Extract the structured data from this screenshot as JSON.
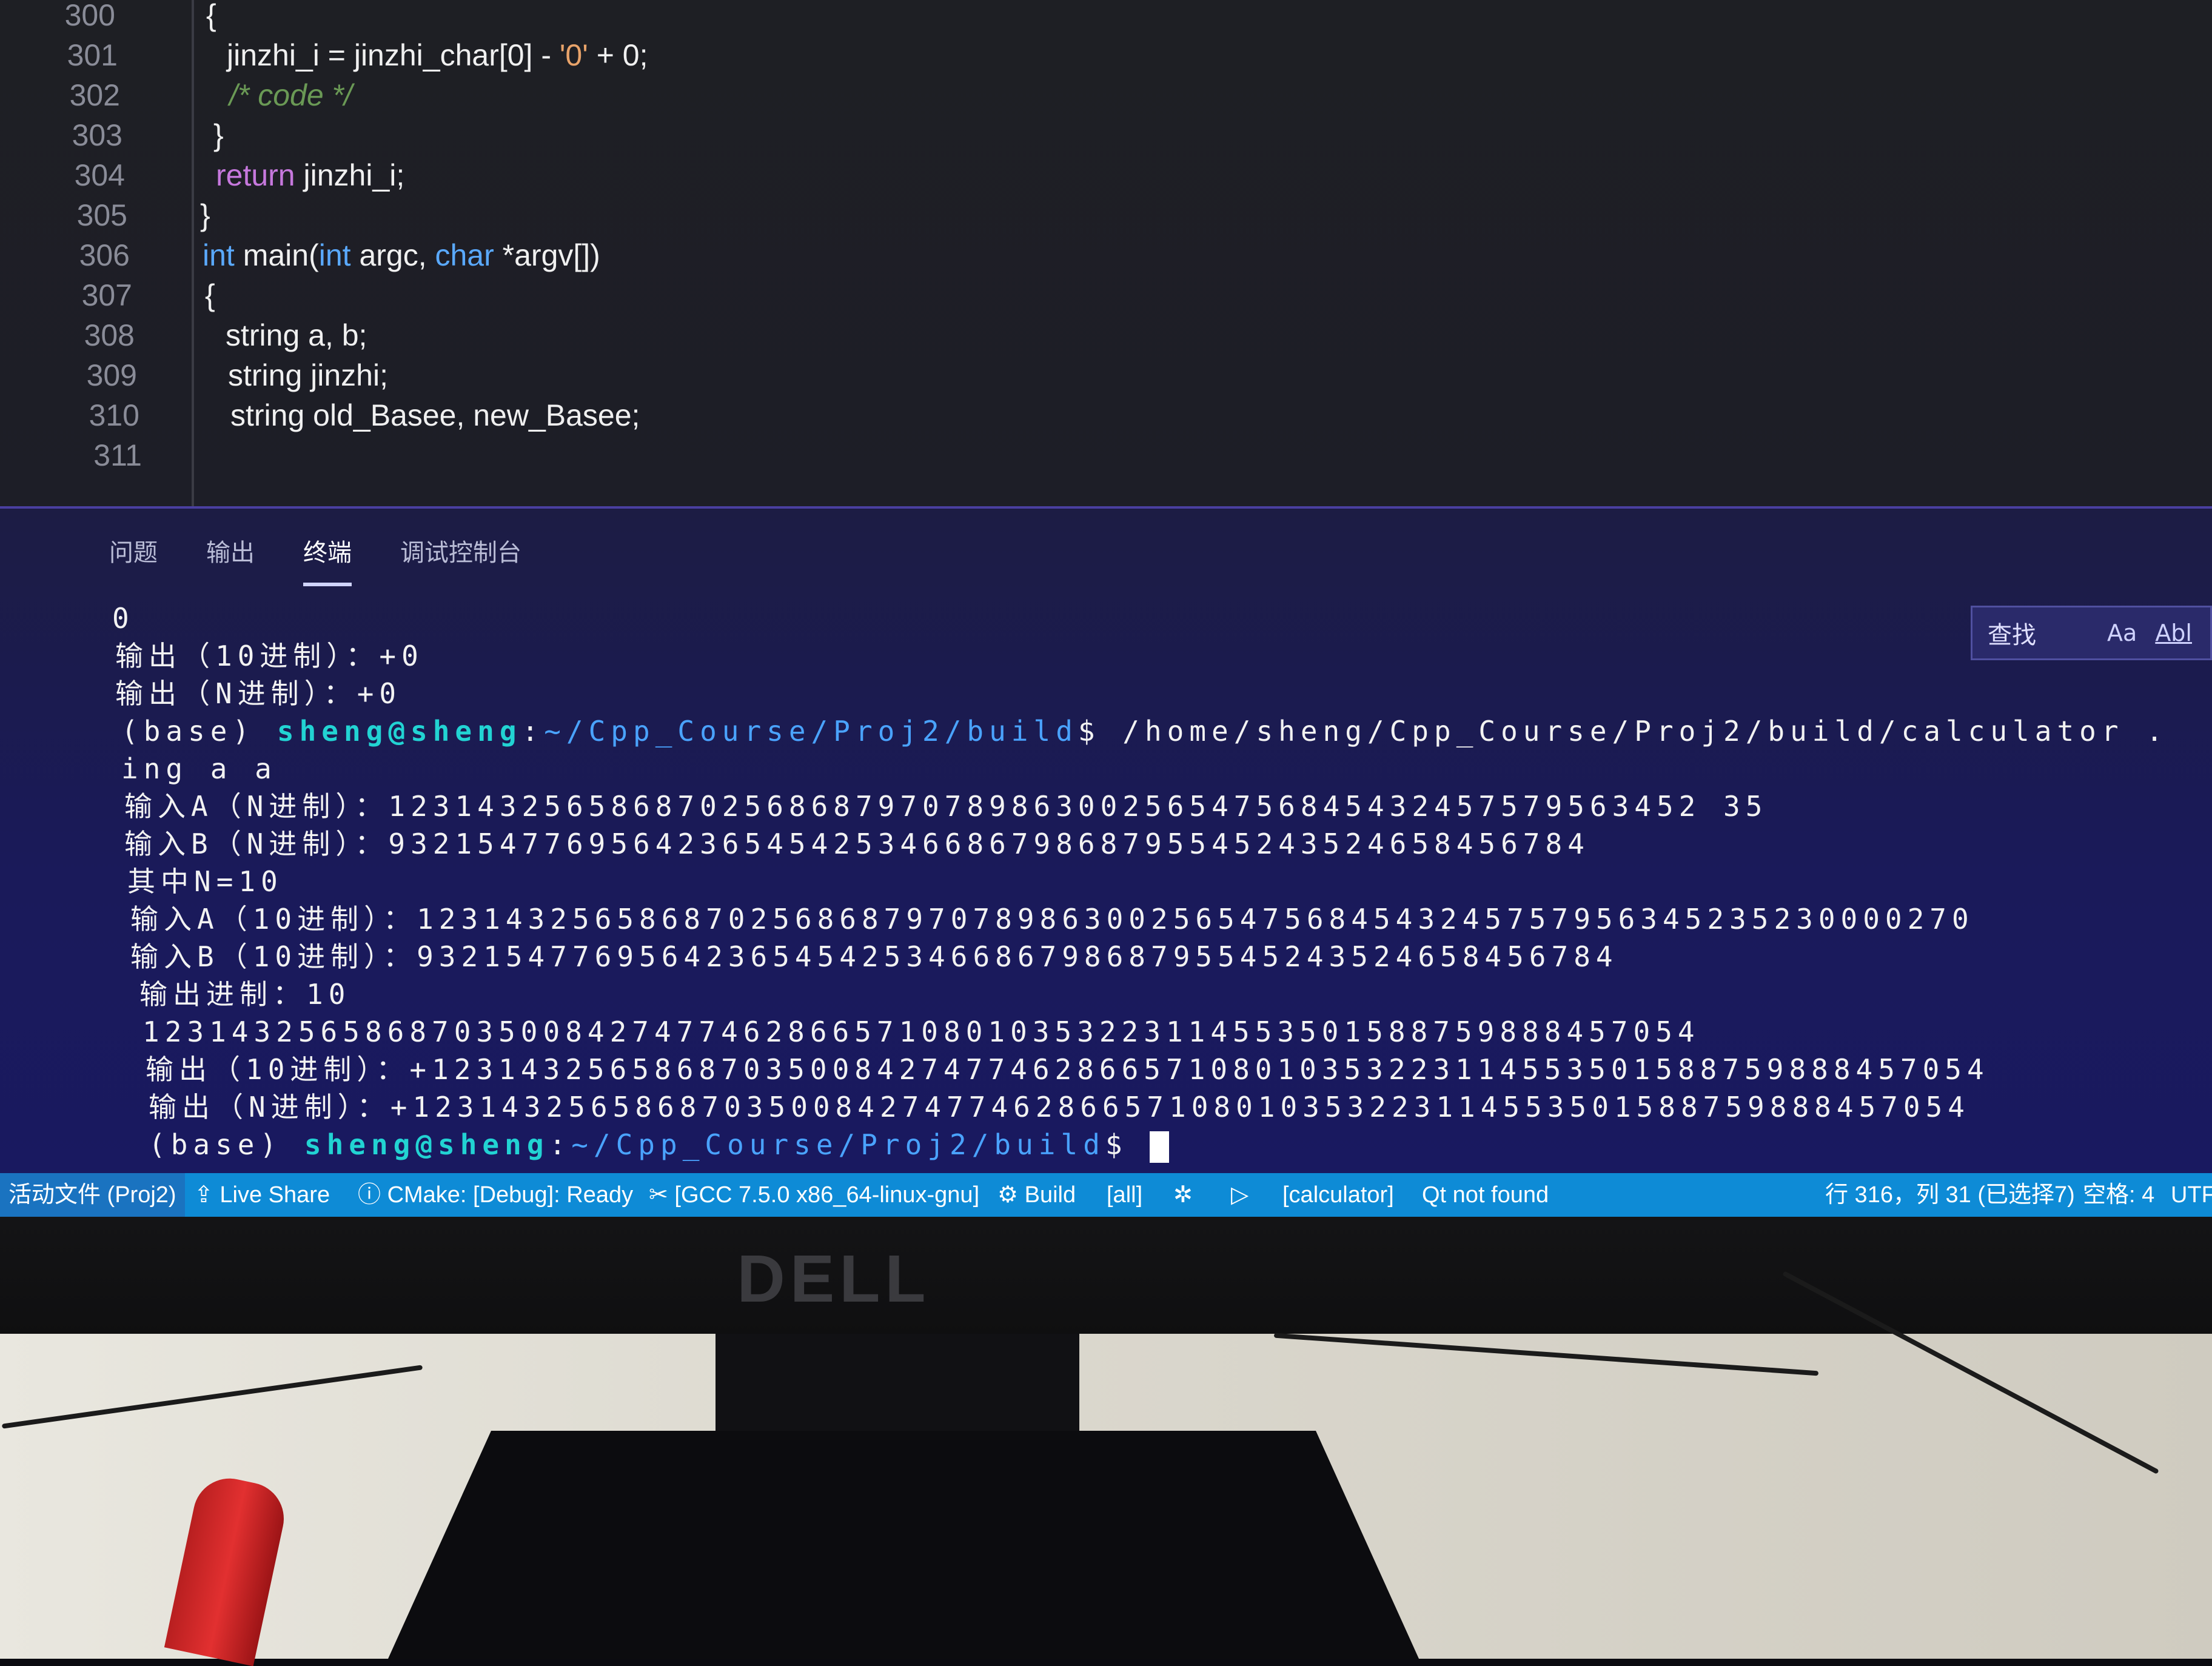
{
  "editor": {
    "lines": [
      {
        "num": "300",
        "indent": 0,
        "tokens": [
          {
            "t": "{",
            "c": "plain"
          }
        ]
      },
      {
        "num": "301",
        "indent": 1,
        "tokens": [
          {
            "t": "jinzhi_i = jinzhi_char[0] - ",
            "c": "plain"
          },
          {
            "t": "'0'",
            "c": "str"
          },
          {
            "t": " + 0;",
            "c": "plain"
          }
        ]
      },
      {
        "num": "302",
        "indent": 1,
        "tokens": [
          {
            "t": "/* code */",
            "c": "com"
          }
        ]
      },
      {
        "num": "303",
        "indent": 0,
        "tokens": [
          {
            "t": "}",
            "c": "plain"
          }
        ]
      },
      {
        "num": "304",
        "indent": 0,
        "tokens": [
          {
            "t": "return",
            "c": "kw"
          },
          {
            "t": " jinzhi_i;",
            "c": "plain"
          }
        ]
      },
      {
        "num": "305",
        "indent": -1,
        "tokens": [
          {
            "t": "}",
            "c": "plain"
          }
        ]
      },
      {
        "num": "306",
        "indent": -1,
        "tokens": [
          {
            "t": "int",
            "c": "type"
          },
          {
            "t": " main(",
            "c": "plain"
          },
          {
            "t": "int",
            "c": "type"
          },
          {
            "t": " argc, ",
            "c": "plain"
          },
          {
            "t": "char",
            "c": "type"
          },
          {
            "t": " *argv[])",
            "c": "plain"
          }
        ]
      },
      {
        "num": "307",
        "indent": -1,
        "tokens": [
          {
            "t": "{",
            "c": "plain"
          }
        ]
      },
      {
        "num": "308",
        "indent": 0,
        "tokens": [
          {
            "t": "string a, b;",
            "c": "plain"
          }
        ]
      },
      {
        "num": "309",
        "indent": 0,
        "tokens": [
          {
            "t": "string jinzhi;",
            "c": "plain"
          }
        ]
      },
      {
        "num": "310",
        "indent": 0,
        "tokens": [
          {
            "t": "string old_Basee, new_Basee;",
            "c": "plain"
          }
        ]
      },
      {
        "num": "311",
        "indent": 0,
        "tokens": []
      }
    ]
  },
  "panel": {
    "tabs": [
      {
        "label": "问题",
        "active": false
      },
      {
        "label": "输出",
        "active": false
      },
      {
        "label": "终端",
        "active": true
      },
      {
        "label": "调试控制台",
        "active": false
      }
    ],
    "find": {
      "label": "查找",
      "match_case": "Aa",
      "whole_word": "Abl"
    }
  },
  "terminal": {
    "lines": [
      [
        {
          "t": "0",
          "c": "plain"
        }
      ],
      [
        {
          "t": "输出（10进制）：+0",
          "c": "plain"
        }
      ],
      [
        {
          "t": "输出（N进制）：+0",
          "c": "plain"
        }
      ],
      [
        {
          "t": "(base) ",
          "c": "plain"
        },
        {
          "t": "sheng@sheng",
          "c": "user"
        },
        {
          "t": ":",
          "c": "plain"
        },
        {
          "t": "~/Cpp_Course/Proj2/build",
          "c": "path"
        },
        {
          "t": "$ /home/sheng/Cpp_Course/Proj2/build/calculator .",
          "c": "plain"
        }
      ],
      [
        {
          "t": "ing a a",
          "c": "plain"
        }
      ],
      [
        {
          "t": "输入A（N进制）：12314325658687025686879707898630025654756845432457579563452 35",
          "c": "plain"
        }
      ],
      [
        {
          "t": "输入B（N进制）：932154776956423654542534668679868795545243524658456784",
          "c": "plain"
        }
      ],
      [
        {
          "t": "其中N=10",
          "c": "plain"
        }
      ],
      [
        {
          "t": "输入A（10进制）：1231432565868702568687970789863002565475684543245757956345235230000270",
          "c": "plain"
        }
      ],
      [
        {
          "t": "输入B（10进制）：932154776956423654542534668679868795545243524658456784",
          "c": "plain"
        }
      ],
      [
        {
          "t": "输出进制：10",
          "c": "plain"
        }
      ],
      [
        {
          "t": "1231432565868703500842747746286657108010353223114553501588759888457054",
          "c": "plain"
        }
      ],
      [
        {
          "t": "输出（10进制）：+1231432565868703500842747746286657108010353223114553501588759888457054",
          "c": "plain"
        }
      ],
      [
        {
          "t": "输出（N进制）：+1231432565868703500842747746286657108010353223114553501588759888457054",
          "c": "plain"
        }
      ],
      [
        {
          "t": "(base) ",
          "c": "plain"
        },
        {
          "t": "sheng@sheng",
          "c": "user"
        },
        {
          "t": ":",
          "c": "plain"
        },
        {
          "t": "~/Cpp_Course/Proj2/build",
          "c": "path"
        },
        {
          "t": "$ ",
          "c": "plain"
        }
      ]
    ]
  },
  "statusbar": {
    "remote": "活动文件 (Proj2)",
    "live_share": "Live Share",
    "cmake": "CMake: [Debug]: Ready",
    "kit": "[GCC 7.5.0 x86_64-linux-gnu]",
    "build": "Build",
    "target": "[all]",
    "launch_target": "[calculator]",
    "qt": "Qt not found",
    "position": "行 316，列 31 (已选择7)",
    "spaces": "空格: 4",
    "encoding": "UTF"
  },
  "monitor": {
    "brand": "DELL"
  },
  "colors": {
    "statusbar": "#0e8bd6",
    "accent_panel": "#4a3fa0",
    "prompt_user": "#22d3d3",
    "prompt_path": "#4aa3ff"
  }
}
